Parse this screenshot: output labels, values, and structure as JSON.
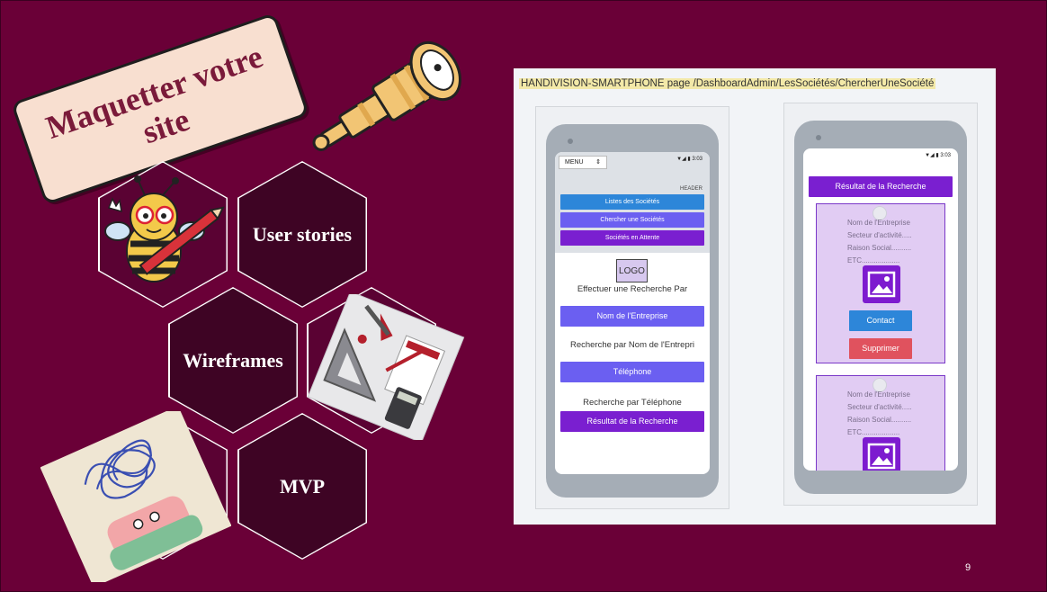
{
  "slide": {
    "title": "Maquetter votre\nsite",
    "page_number": "9",
    "colors": {
      "background": "#6a0037",
      "hex_fill": "#3e0424",
      "accent_purple": "#7a1fd0"
    }
  },
  "hexagons": [
    {
      "label": "User stories"
    },
    {
      "label": "Wireframes"
    },
    {
      "label": "MVP"
    }
  ],
  "icons": [
    "telescope-icon",
    "bee-pencil-illustration",
    "drafting-tools-illustration",
    "tangled-thoughts-illustration"
  ],
  "mockup": {
    "caption": "HANDIVISION-SMARTPHONE  page /DashboardAdmin/LesSociétés/ChercherUneSociété",
    "phone1": {
      "status": "▼◢ ▮ 3:03",
      "menu": "MENU",
      "menu_arrow": "⇕",
      "header_label": "HEADER",
      "nav": [
        "Listes des Sociétés",
        "Chercher une Sociétés",
        "Sociétés en Attente"
      ],
      "logo": "LOGO",
      "search_title": "Effectuer une Recherche Par",
      "btn_company": "Nom de l'Entreprise",
      "label_company": "Recherche par Nom de l'Entrepri",
      "btn_phone": "Téléphone",
      "label_phone": "Recherche par Téléphone",
      "btn_result": "Résultat de la Recherche"
    },
    "phone2": {
      "status": "▼◢ ▮ 3:03",
      "result_header": "Résultat de la Recherche",
      "card_lines": [
        "Nom de l'Entreprise",
        "Secteur d'activité.....",
        "Raison Social..........",
        "ETC..................."
      ],
      "contact": "Contact",
      "delete": "Supprimer"
    }
  }
}
